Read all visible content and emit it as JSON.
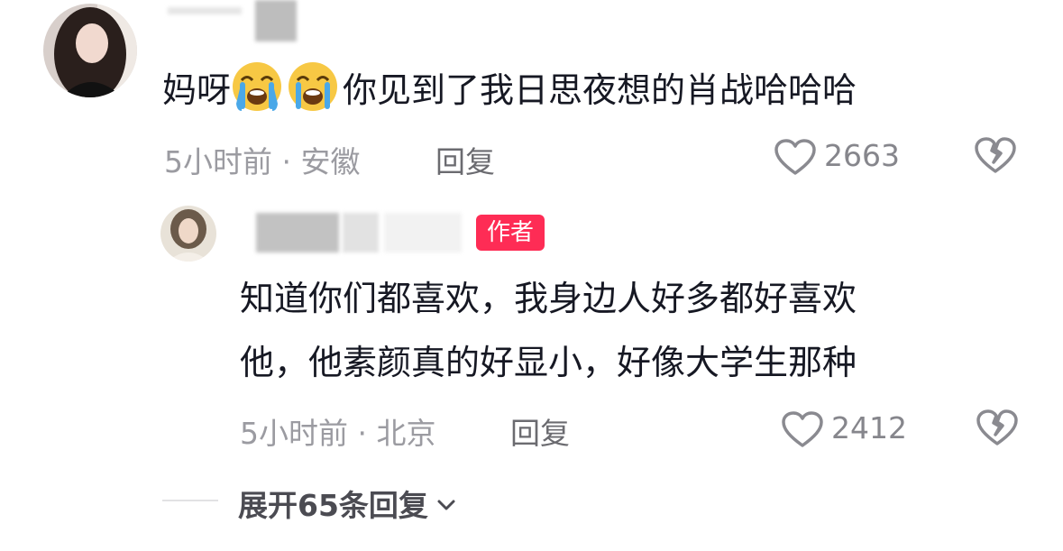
{
  "comment": {
    "text_pre": "妈呀",
    "emoji_icons": [
      "loudly-crying-face-icon",
      "loudly-crying-face-icon"
    ],
    "text_post": "你见到了我日思夜想的肖战哈哈哈",
    "meta": "5小时前 · 安徽",
    "reply_label": "回复",
    "like_count": "2663"
  },
  "reply": {
    "badge": "作者",
    "text_line1": "知道你们都喜欢，我身边人好多都好喜欢",
    "text_line2": "他，他素颜真的好显小，好像大学生那种",
    "meta": "5小时前 · 北京",
    "reply_label": "回复",
    "like_count": "2412"
  },
  "expand": {
    "label": "展开65条回复"
  },
  "colors": {
    "badge": "#fe2c55",
    "emoji_face": "#f7c844",
    "emoji_tears": "#4aa8e8"
  }
}
